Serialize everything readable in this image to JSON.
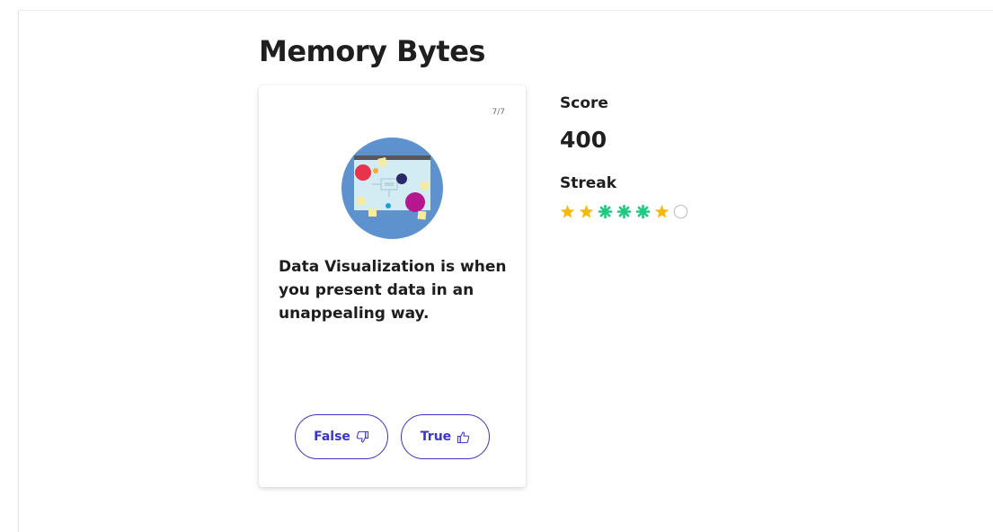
{
  "app": {
    "title": "Memory Bytes"
  },
  "card": {
    "progress": "7/7",
    "illustration_icon": "data-visualization-board-illustration",
    "question": "Data Visualization is when you present data in an unappealing way.",
    "false_label": "False",
    "false_icon": "thumbs-down-icon",
    "true_label": "True",
    "true_icon": "thumbs-up-icon"
  },
  "score": {
    "label": "Score",
    "value": "400"
  },
  "streak": {
    "label": "Streak",
    "items": [
      {
        "type": "star",
        "icon": "star-icon",
        "color": "#f5b90a"
      },
      {
        "type": "star",
        "icon": "star-icon",
        "color": "#f5b90a"
      },
      {
        "type": "burst",
        "icon": "burst-icon",
        "color": "#1ec980"
      },
      {
        "type": "burst",
        "icon": "burst-icon",
        "color": "#1ec980"
      },
      {
        "type": "burst",
        "icon": "burst-icon",
        "color": "#1ec980"
      },
      {
        "type": "star",
        "icon": "star-icon",
        "color": "#f5b90a"
      },
      {
        "type": "empty",
        "icon": "empty-circle-icon",
        "color": "#c4c4c4"
      }
    ]
  },
  "colors": {
    "accent": "#3b34c9",
    "star": "#f5b90a",
    "burst": "#1ec980"
  }
}
